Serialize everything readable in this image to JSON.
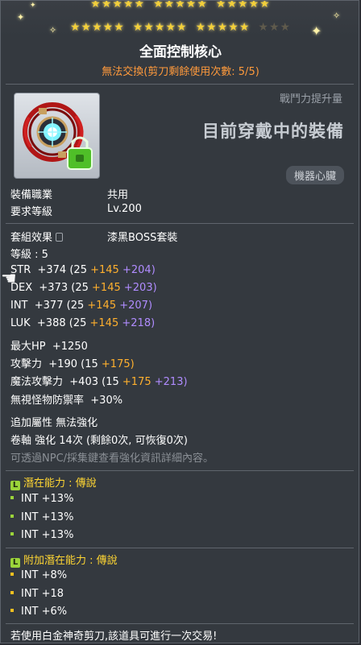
{
  "stars": {
    "row1_lit": 15,
    "row2_lit": 15,
    "row2_dim": 3
  },
  "header": {
    "title": "全面控制核心",
    "trade_note": "無法交換(剪刀剩餘使用次數: 5/5)"
  },
  "side": {
    "boost_label": "戰鬥力提升量",
    "equipped_label": "目前穿戴中的裝備",
    "category": "機器心臟"
  },
  "req": {
    "job_label": "裝備職業",
    "job_value": "共用",
    "level_label": "要求等級",
    "level_value": "Lv.200"
  },
  "set": {
    "label": "套組效果",
    "value": "漆黑BOSS套裝"
  },
  "level_line": "等級 : 5",
  "stats": [
    {
      "name": "STR",
      "total": "+374",
      "base": "(25",
      "bonus": "+145",
      "star": "+204)"
    },
    {
      "name": "DEX",
      "total": "+373",
      "base": "(25",
      "bonus": "+145",
      "star": "+203)"
    },
    {
      "name": "INT",
      "total": "+377",
      "base": "(25",
      "bonus": "+145",
      "star": "+207)"
    },
    {
      "name": "LUK",
      "total": "+388",
      "base": "(25",
      "bonus": "+145",
      "star": "+218)"
    }
  ],
  "maxhp": {
    "name": "最大HP",
    "value": "+1250"
  },
  "atk": {
    "name": "攻擊力",
    "value": "+190",
    "base": "(15",
    "bonus": "+175)"
  },
  "matk": {
    "name": "魔法攻擊力",
    "value": "+403",
    "base": "(15",
    "bonus": "+175",
    "star": "+213)"
  },
  "ignore": {
    "name": "無視怪物防禦率",
    "value": "+30%"
  },
  "extra": {
    "attr_label": "追加屬性",
    "attr_value": "無法強化",
    "scroll_label": "卷軸",
    "scroll_value": "強化 14次 (剩餘0次, 可恢復0次)",
    "hint": "可透過NPC/採集鍵查看強化資訊詳細內容。"
  },
  "potential": {
    "icon": "L",
    "title": "潛在能力 : 傳說",
    "lines": [
      "INT +13%",
      "INT +13%",
      "INT +13%"
    ]
  },
  "bonus_potential": {
    "icon": "L",
    "title": "附加潛在能力 : 傳說",
    "lines": [
      "INT +8%",
      "INT +18",
      "INT +6%"
    ]
  },
  "footer": "若使用白金神奇剪刀,該道具可進行一次交易!",
  "icons": {
    "item": "machine-heart-icon",
    "lock": "lock-icon",
    "cursor": "hand-cursor-icon"
  }
}
